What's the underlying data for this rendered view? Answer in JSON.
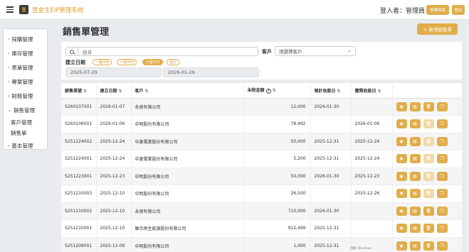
{
  "header": {
    "app_title": "昱金生EIP管理系統",
    "logo_text": "昱",
    "user_label": "登入者：管理員",
    "change_password": "密碼修改",
    "logout": "登出"
  },
  "sidebar": {
    "items": [
      {
        "label": "採購管理",
        "chev": "›"
      },
      {
        "label": "庫存管理",
        "chev": "›"
      },
      {
        "label": "表單管理",
        "chev": "›"
      },
      {
        "label": "專案管理",
        "chev": "›"
      },
      {
        "label": "財務管理",
        "chev": "›"
      },
      {
        "label": "銷售管理",
        "chev": "⌄"
      },
      {
        "label": "基本管理",
        "chev": "›"
      }
    ],
    "sub_items": [
      "客戶管理",
      "銷售單"
    ]
  },
  "page": {
    "title": "銷售單管理",
    "new_button": "＋ 新增銷售單"
  },
  "filters": {
    "search_placeholder": "搜尋",
    "customer_label": "客戶",
    "customer_placeholder": "請選擇客戶",
    "date_label": "建立日期",
    "chips": [
      "一個月內",
      "三個月內",
      "六個月內",
      "自訂"
    ],
    "active_chip": "六個月內",
    "start_date": "2025-07-29",
    "end_date": "2026-01-29"
  },
  "table": {
    "columns": [
      "銷售單號",
      "建立日期",
      "客戶",
      "未稅金額",
      "預計收款日",
      "實際收款日",
      ""
    ],
    "sort_icon": "⇅",
    "info_icon": "?",
    "rows": [
      {
        "no": "S260107001",
        "created": "2026-01-07",
        "customer": "永德有限公司",
        "amount": "12,000",
        "expected": "2026-01-30",
        "actual": "",
        "status": "editable"
      },
      {
        "no": "S260106001",
        "created": "2026-01-06",
        "customer": "中明股份有限公司",
        "amount": "78,492",
        "expected": "",
        "actual": "2026-01-06",
        "status": "paid"
      },
      {
        "no": "S251224002",
        "created": "2025-12-24",
        "customer": "中菱電業股份有限公司",
        "amount": "50,000",
        "expected": "2025-12-31",
        "actual": "2025-12-24",
        "status": "paid"
      },
      {
        "no": "S251224001",
        "created": "2025-12-24",
        "customer": "中菱電業股份有限公司",
        "amount": "5,200",
        "expected": "2025-12-31",
        "actual": "2025-12-24",
        "status": "paid"
      },
      {
        "no": "S251223001",
        "created": "2025-12-23",
        "customer": "中明股份有限公司",
        "amount": "50,000",
        "expected": "2026-01-30",
        "actual": "2025-12-23",
        "status": "paid"
      },
      {
        "no": "S251210003",
        "created": "2025-12-10",
        "customer": "中明股份有限公司",
        "amount": "26,500",
        "expected": "",
        "actual": "2025-12-26",
        "status": "paid"
      },
      {
        "no": "S251210002",
        "created": "2025-12-10",
        "customer": "永德有限公司",
        "amount": "710,000",
        "expected": "2026-01-30",
        "actual": "",
        "status": "editable"
      },
      {
        "no": "S251210001",
        "created": "2025-12-10",
        "customer": "聯合再生能源股份有限公司",
        "amount": "912,499",
        "expected": "2025-12-31",
        "actual": "",
        "status": "editable"
      },
      {
        "no": "S251209001",
        "created": "2025-12-09",
        "customer": "中明股份有限公司",
        "amount": "1,000",
        "expected": "2025-12-31",
        "actual": "",
        "status": "editable"
      }
    ]
  },
  "icons": {
    "view": "◉",
    "print": "▤",
    "delete": "🗑",
    "copy": "❐"
  },
  "colors": {
    "accent": "#e0ad4b",
    "accent_disabled": "#f0d9a8",
    "title": "#d9a02e"
  },
  "watermark": "啟動 Windows"
}
